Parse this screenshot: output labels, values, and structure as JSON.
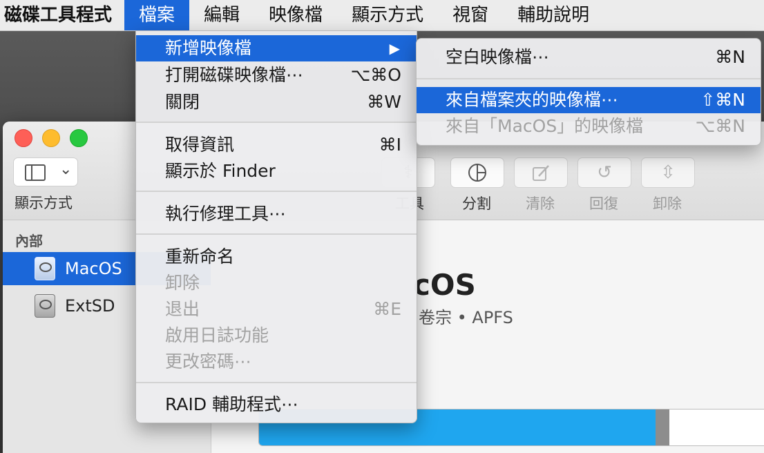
{
  "menubar": {
    "app": "磁碟工具程式",
    "items": [
      "檔案",
      "編輯",
      "映像檔",
      "顯示方式",
      "視窗",
      "輔助說明"
    ]
  },
  "file_menu": {
    "new_image": "新增映像檔",
    "submenu_arrow": "▶",
    "open_image": "打開磁碟映像檔⋯",
    "open_image_sc": "⌥⌘O",
    "close": "關閉",
    "close_sc": "⌘W",
    "get_info": "取得資訊",
    "get_info_sc": "⌘I",
    "show_in_finder": "顯示於 Finder",
    "run_first_aid": "執行修理工具⋯",
    "rename": "重新命名",
    "unmount": "卸除",
    "eject": "退出",
    "eject_sc": "⌘E",
    "enable_journaling": "啟用日誌功能",
    "change_password": "更改密碼⋯",
    "raid_assistant": "RAID 輔助程式⋯"
  },
  "submenu": {
    "blank_image": "空白映像檔⋯",
    "blank_image_sc": "⌘N",
    "from_folder": "來自檔案夾的映像檔⋯",
    "from_folder_sc": "⇧⌘N",
    "from_macos": "來自「MacOS」的映像檔",
    "from_macos_sc": "⌥⌘N"
  },
  "toolbar": {
    "view_label": "顯示方式",
    "chevron": "⌄",
    "partial_label": "工具",
    "partition": "分割",
    "erase": "清除",
    "restore": "回復",
    "unmount": "卸除"
  },
  "sidebar": {
    "section": "內部",
    "items": [
      {
        "label": "MacOS",
        "selected": true
      },
      {
        "label": "ExtSD",
        "selected": false
      }
    ]
  },
  "main": {
    "volume_title": "cOS",
    "volume_subtitle": "卷宗 • APFS",
    "usage_fraction": 0.775,
    "other_fraction": 0.028
  },
  "colors": {
    "selection": "#1b67d9",
    "usage": "#1fa6ef"
  }
}
